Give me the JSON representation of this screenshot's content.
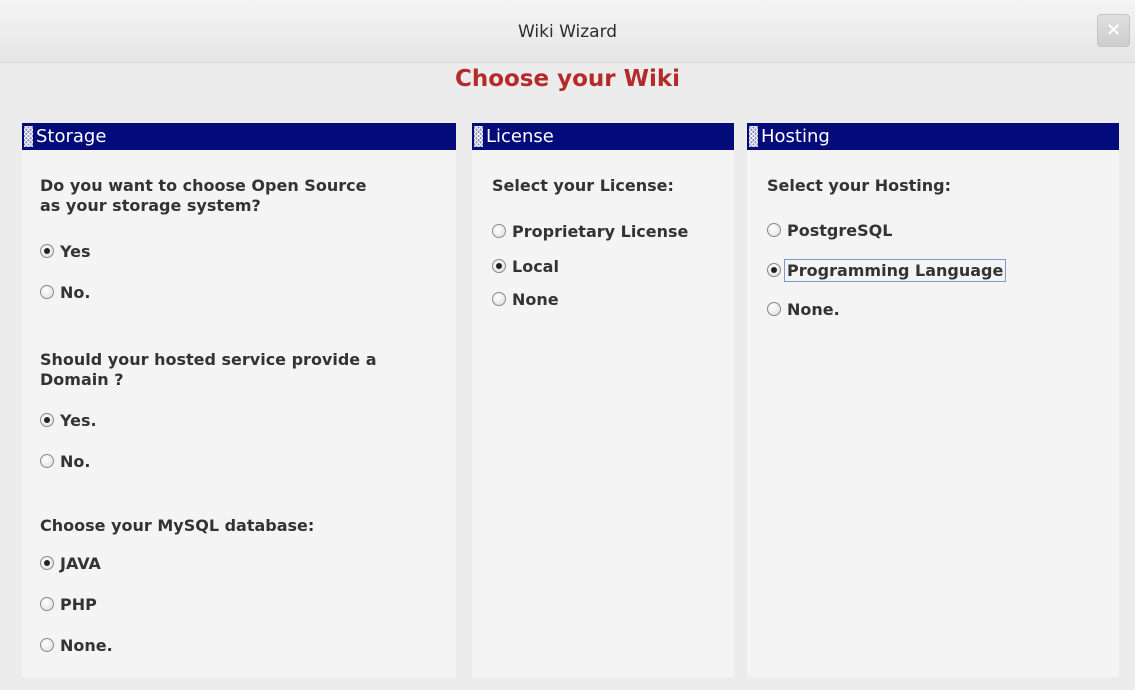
{
  "window": {
    "title": "Wiki Wizard",
    "close_label": "×"
  },
  "heading": "Choose your Wiki",
  "panels": {
    "storage": {
      "title": "Storage",
      "q1": {
        "text_line1": "Do you want to choose Open Source",
        "text_line2": "as your storage system?",
        "options": [
          {
            "label": "Yes",
            "selected": true
          },
          {
            "label": "No.",
            "selected": false
          }
        ]
      },
      "q2": {
        "text_line1": "Should your hosted service provide a",
        "text_line2": "Domain ?",
        "options": [
          {
            "label": "Yes.",
            "selected": true
          },
          {
            "label": "No.",
            "selected": false
          }
        ]
      },
      "q3": {
        "text": "Choose your MySQL database:",
        "options": [
          {
            "label": "JAVA",
            "selected": true
          },
          {
            "label": "PHP",
            "selected": false
          },
          {
            "label": "None.",
            "selected": false
          }
        ]
      }
    },
    "license": {
      "title": "License",
      "question": "Select your License:",
      "options": [
        {
          "label": "Proprietary License",
          "selected": false
        },
        {
          "label": "Local",
          "selected": true
        },
        {
          "label": "None",
          "selected": false
        }
      ]
    },
    "hosting": {
      "title": "Hosting",
      "question": "Select your Hosting:",
      "options": [
        {
          "label": "PostgreSQL",
          "selected": false
        },
        {
          "label": "Programming Language",
          "selected": true
        },
        {
          "label": "None.",
          "selected": false
        }
      ]
    }
  },
  "colors": {
    "header_bg": "#030a7a",
    "heading": "#b52a2a",
    "window_bg": "#ececec",
    "panel_bg": "#f4f4f4"
  }
}
